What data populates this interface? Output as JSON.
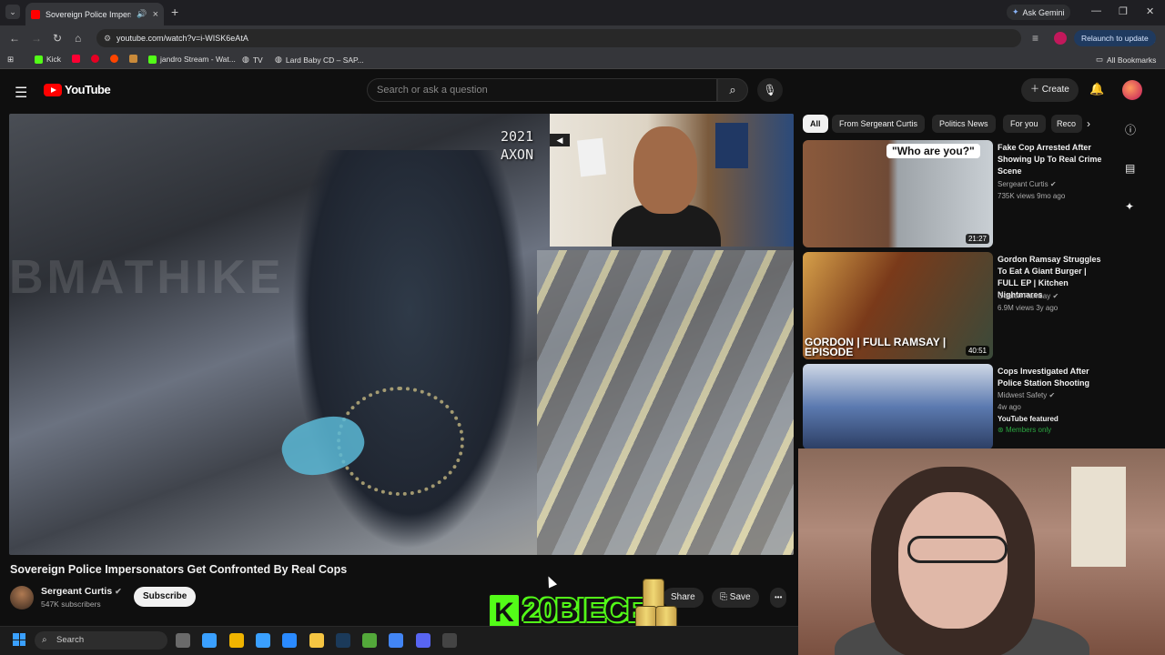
{
  "browser": {
    "tab_title": "Sovereign Police Imperson",
    "url": "youtube.com/watch?v=i-WISK6eAtA",
    "ask_gemini": "Ask Gemini",
    "relaunch": "Relaunch to update",
    "bookmarks": [
      {
        "label": "Kick",
        "color": "#53fc18"
      },
      {
        "label": "",
        "color": "#ff0033"
      },
      {
        "label": "",
        "color": "#ff0033"
      },
      {
        "label": "",
        "color": "#e0403a"
      },
      {
        "label": "",
        "color": "#c98a3a"
      },
      {
        "label": "jandro Stream - Wat...",
        "color": "#53fc18"
      },
      {
        "label": "TV",
        "color": "#888888"
      },
      {
        "label": "Lard Baby CD – SAP...",
        "color": "#888888"
      }
    ],
    "all_bookmarks": "All Bookmarks"
  },
  "youtube": {
    "logo_text": "YouTube",
    "search_placeholder": "Search or ask a question",
    "create_label": "Create",
    "video": {
      "watermark": "BMATHIKE",
      "overlay_year": "2021",
      "overlay_brand": "AXON",
      "title": "Sovereign Police Impersonators Get Confronted By Real Cops",
      "channel": "Sergeant Curtis",
      "subscribers": "547K subscribers",
      "subscribe_label": "Subscribe",
      "share_label": "Share",
      "save_label": "Save",
      "more_label": "•••"
    },
    "chips": [
      "All",
      "From Sergeant Curtis",
      "Politics News",
      "For you",
      "Reco"
    ],
    "recommendations": [
      {
        "title": "Fake Cop Arrested After Showing Up To Real Crime Scene",
        "channel": "Sergeant Curtis",
        "meta": "735K views  9mo ago",
        "duration": "21:27",
        "thumb_caption": "\"Who are you?\""
      },
      {
        "title": "Gordon Ramsay Struggles To Eat A Giant Burger | FULL EP | Kitchen Nightmares",
        "channel": "Gordon Ramsay",
        "meta": "6.9M views  3y ago",
        "duration": "40:51",
        "thumb_caption": "GORDON | FULL RAMSAY | EPISODE"
      },
      {
        "title": "Cops Investigated After Police Station Shooting",
        "channel": "Midwest Safety",
        "meta": "4w ago",
        "badge_featured": "YouTube featured",
        "badge_members": "Members only"
      }
    ]
  },
  "stream_overlay": {
    "badge": "K",
    "name": "20BIECE"
  },
  "taskbar": {
    "search_label": "Search",
    "icons": [
      {
        "name": "task-view-icon",
        "color": "#6a6a6a"
      },
      {
        "name": "widgets-icon",
        "color": "#3aa0ff"
      },
      {
        "name": "edge-icon",
        "color": "#f0b400"
      },
      {
        "name": "photos-icon",
        "color": "#3aa0ff"
      },
      {
        "name": "calculator-icon",
        "color": "#2a8aff"
      },
      {
        "name": "file-explorer-icon",
        "color": "#f5c542"
      },
      {
        "name": "steam-icon",
        "color": "#1b3a5a"
      },
      {
        "name": "minecraft-icon",
        "color": "#53a83a"
      },
      {
        "name": "chrome-icon",
        "color": "#4285f4"
      },
      {
        "name": "discord-icon",
        "color": "#5865f2"
      },
      {
        "name": "obs-icon",
        "color": "#444444"
      }
    ]
  }
}
